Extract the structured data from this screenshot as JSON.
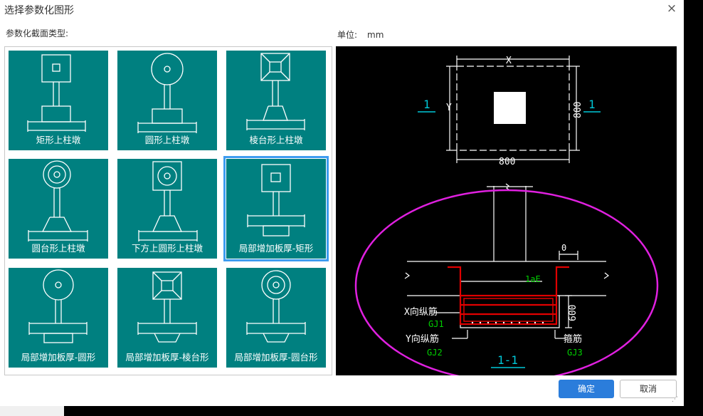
{
  "dialog": {
    "title": "选择参数化图形",
    "close_symbol": "×",
    "section_label": "参数化截面类型:",
    "unit_label": "单位:",
    "unit_value": "mm",
    "ok_label": "确定",
    "cancel_label": "取消"
  },
  "tiles": [
    {
      "caption": "矩形上柱墩"
    },
    {
      "caption": "圆形上柱墩"
    },
    {
      "caption": "棱台形上柱墩"
    },
    {
      "caption": "圆台形上柱墩"
    },
    {
      "caption": "下方上圆形上柱墩"
    },
    {
      "caption": "局部增加板厚-矩形",
      "selected": true
    },
    {
      "caption": "局部增加板厚-圆形"
    },
    {
      "caption": "局部增加板厚-棱台形"
    },
    {
      "caption": "局部增加板厚-圆台形"
    }
  ],
  "preview": {
    "dim_x": "X",
    "dim_y": "Y",
    "dim_bottom": "800",
    "dim_right": "800",
    "section_mark_left": "1",
    "section_mark_right": "1",
    "dim_offset": "0",
    "lae_label": "1aE",
    "dim_thickness": "600",
    "x_rebar_label": "X向纵筋",
    "x_rebar_code": "GJ1",
    "y_rebar_label": "Y向纵筋",
    "y_rebar_code": "GJ2",
    "stirrup_label": "箍筋",
    "stirrup_code": "GJ3",
    "section_title": "1-1"
  },
  "colors": {
    "tile_bg": "#008080",
    "selected_border": "#3d9cf0",
    "ok_button": "#2b7ddb",
    "rebar_red": "#e00000",
    "label_green": "#00d000",
    "mark_cyan": "#00c8d8",
    "ellipse_magenta": "#e020e0"
  }
}
